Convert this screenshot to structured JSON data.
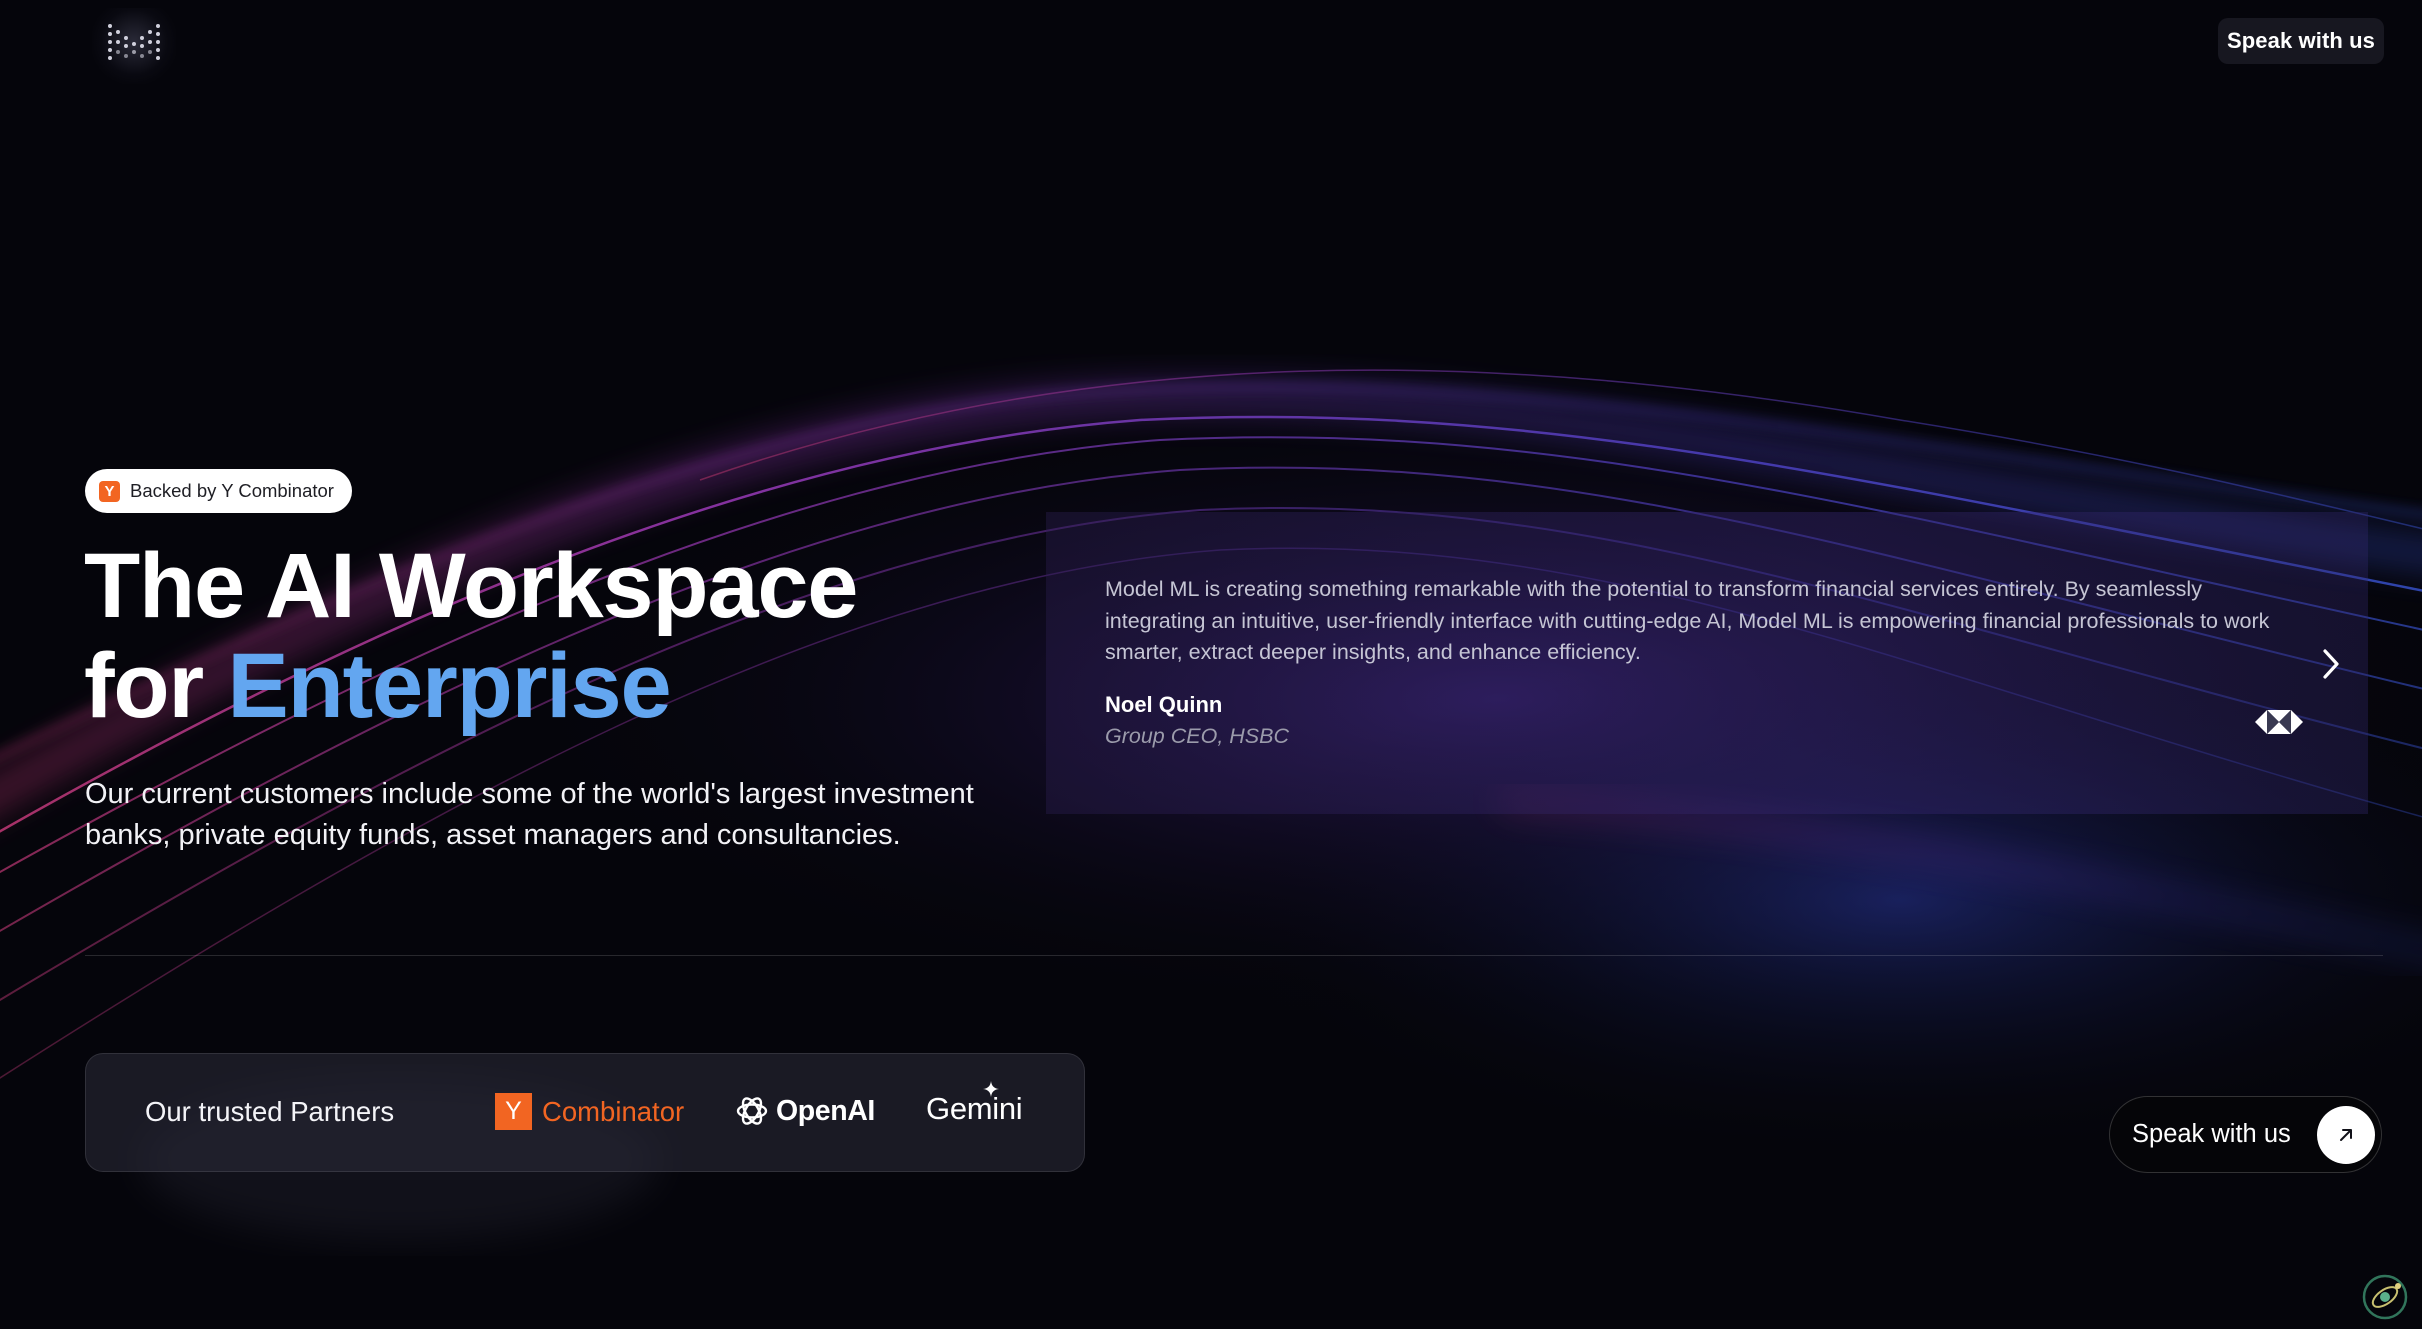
{
  "colors": {
    "background": "#05050b",
    "accent_blue": "#63a6f0",
    "yc_orange": "#f26522",
    "wave_purple": "#b040d0",
    "wave_blue": "#4858e0"
  },
  "header": {
    "logo_icon": "dot-grid-m-logo-icon",
    "cta_label": "Speak with us"
  },
  "hero": {
    "badge": {
      "icon": "y-combinator-icon",
      "icon_letter": "Y",
      "label": "Backed by Y Combinator"
    },
    "headline_line1": "The AI Workspace",
    "headline_for": "for ",
    "headline_accent": "Enterprise",
    "subtext": "Our current customers include some of the world's largest investment banks, private equity funds, asset managers and consultancies."
  },
  "testimonial": {
    "quote": "Model ML is creating something remarkable with the potential to transform financial services entirely. By seamlessly integrating an intuitive, user-friendly interface with cutting-edge AI, Model ML is empowering financial professionals to work smarter, extract deeper insights, and enhance efficiency.",
    "author": "Noel Quinn",
    "role": "Group CEO, HSBC",
    "company_logo": "hsbc-logo-icon",
    "next_icon": "chevron-right-icon"
  },
  "partners": {
    "title": "Our trusted Partners",
    "yc": {
      "letter": "Y",
      "name": "Combinator"
    },
    "openai": {
      "icon": "openai-knot-icon",
      "name": "OpenAI"
    },
    "gemini": {
      "name": "Gemini",
      "icon": "sparkle-icon"
    }
  },
  "cta": {
    "label": "Speak with us",
    "icon": "arrow-up-right-icon"
  },
  "corner": {
    "icon": "assistant-orbit-icon"
  }
}
